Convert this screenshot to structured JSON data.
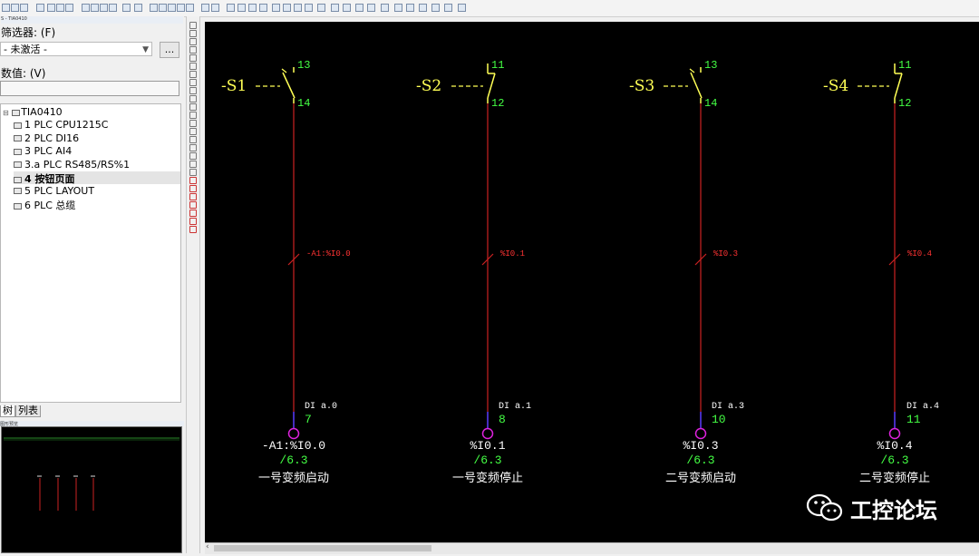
{
  "left_panel": {
    "title": "S - TIA0410",
    "filter_label": "筛选器: (F)",
    "filter_value": "- 未激活 -",
    "dots_button": "...",
    "value_label": "数值: (V)",
    "value_input": "",
    "tree_root": "TIA0410",
    "tree_items": [
      {
        "label": "1 PLC CPU1215C"
      },
      {
        "label": "2 PLC DI16"
      },
      {
        "label": "3 PLC AI4"
      },
      {
        "label": "3.a PLC RS485/RS%1"
      },
      {
        "label": "4 按钮页面"
      },
      {
        "label": "5 PLC LAYOUT"
      },
      {
        "label": "6 PLC 总缆"
      }
    ],
    "tabs": [
      "树",
      "列表"
    ],
    "preview_title": "图形预览"
  },
  "schematic": {
    "columns": [
      {
        "name": "-S1",
        "top_num": "13",
        "bottom_num": "14",
        "wire_addr": "-A1:%I0.0",
        "di_label": "DI a.0",
        "di_num": "7",
        "io_addr": "-A1:%I0.0",
        "io_ref": "/6.3",
        "io_desc": "一号变频启动"
      },
      {
        "name": "-S2",
        "top_num": "11",
        "bottom_num": "12",
        "wire_addr": "%I0.1",
        "di_label": "DI a.1",
        "di_num": "8",
        "io_addr": "%I0.1",
        "io_ref": "/6.3",
        "io_desc": "一号变频停止"
      },
      {
        "name": "-S3",
        "top_num": "13",
        "bottom_num": "14",
        "wire_addr": "%I0.3",
        "di_label": "DI a.3",
        "di_num": "10",
        "io_addr": "%I0.3",
        "io_ref": "/6.3",
        "io_desc": "二号变频启动"
      },
      {
        "name": "-S4",
        "top_num": "11",
        "bottom_num": "12",
        "wire_addr": "%I0.4",
        "di_label": "DI a.4",
        "di_num": "11",
        "io_addr": "%I0.4",
        "io_ref": "/6.3",
        "io_desc": "二号变频停止"
      }
    ]
  },
  "watermark": {
    "text": "工控论坛",
    "icon": "wechat-icon"
  },
  "colors": {
    "canvas": "#000000",
    "wire": "#cc2222",
    "terminal": "#dd22dd",
    "green_text": "#44ff44",
    "yellow_symbol": "#ffff55"
  }
}
